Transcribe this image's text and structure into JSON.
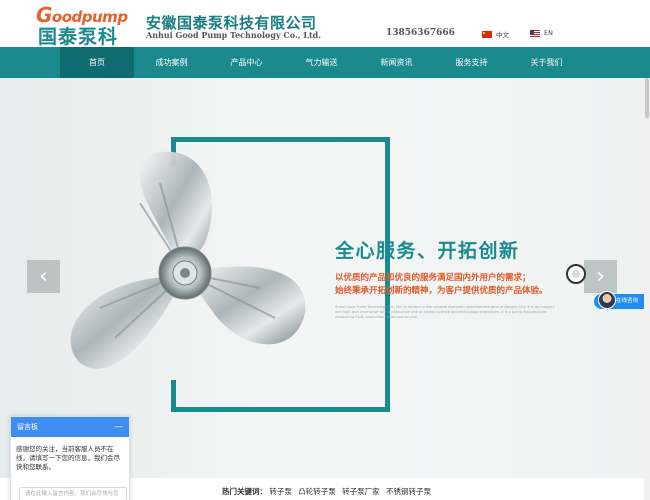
{
  "header": {
    "logo_word": "Goodpump",
    "logo_cn": "国泰泵科",
    "company_cn": "安徽国泰泵科技有限公司",
    "company_en": "Anhui Good Pump Technology Co., Ltd.",
    "phone": "13856367666",
    "lang_cn": "中文",
    "lang_en": "EN"
  },
  "nav": {
    "items": [
      {
        "label": "首页"
      },
      {
        "label": "成功案例"
      },
      {
        "label": "产品中心"
      },
      {
        "label": "气力输送"
      },
      {
        "label": "新闻资讯"
      },
      {
        "label": "服务支持"
      },
      {
        "label": "关于我们"
      }
    ]
  },
  "banner": {
    "slogan": "全心服务、开拓创新",
    "sub1": "以优质的产品和优良的服务满足国内外用户的需求；",
    "sub2": "始终秉承开拓创新的精神，为客户提供优质的产品体验。",
    "fine": "Anhui Good Pump Technology Co., Ltd. is located in the national economic development zone of Bengbu City. It is an industry and high-tech enterprise with a production unit of limited science and technology enterprises. It is a pump manufacturer integrating R&D, production, sales and service.",
    "arrow_left": "‹",
    "arrow_right": "›"
  },
  "consult": {
    "label": "在线咨询"
  },
  "message_board": {
    "title": "留言板",
    "minimize": "—",
    "text": "感谢您的关注，当前客服人员不在线，请填写一下您的信息，我们会尽快和您联系。",
    "placeholder": "请在此输入留言内容，我们会尽快与您"
  },
  "keywords": {
    "title": "热门关键词：",
    "items": [
      "转子泵",
      "凸轮转子泵",
      "转子泵厂家",
      "不锈钢转子泵"
    ]
  },
  "colors": {
    "brand_teal": "#1b8a8f",
    "brand_orange": "#e8602c",
    "chat_blue": "#3d8ef0"
  },
  "icons": {
    "flag_cn": "china-flag-icon",
    "flag_en": "us-flag-icon",
    "prev": "chevron-left-icon",
    "next": "chevron-right-icon",
    "consult": "agent-avatar-icon"
  }
}
